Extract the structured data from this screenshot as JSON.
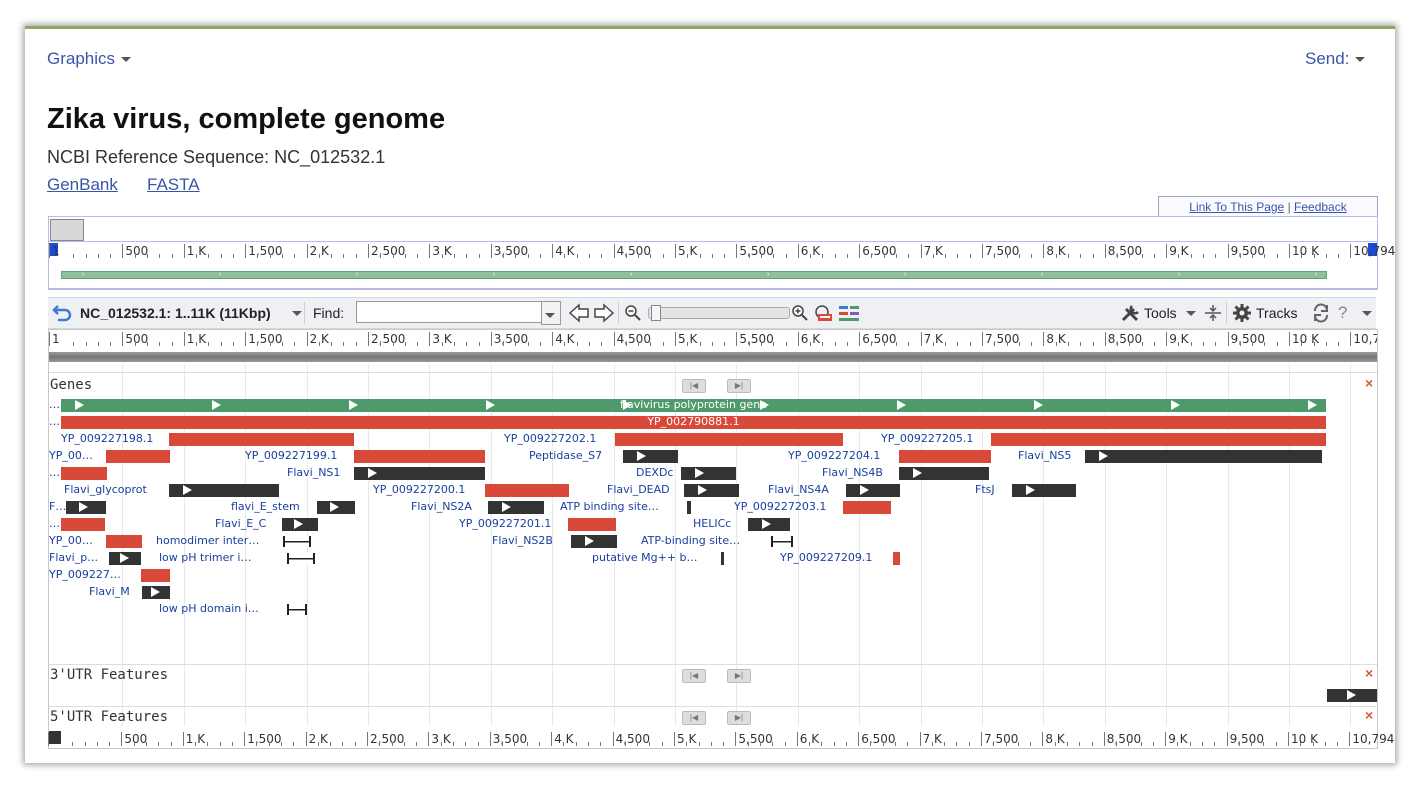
{
  "header": {
    "graphics_menu": "Graphics",
    "send_menu": "Send:",
    "title": "Zika virus, complete genome",
    "subtitle": "NCBI Reference Sequence: NC_012532.1",
    "links": [
      "GenBank",
      "FASTA"
    ]
  },
  "link_box": {
    "link_to_page": "Link To This Page",
    "separator": "|",
    "feedback": "Feedback"
  },
  "ruler_labels": [
    "500",
    "1 K",
    "1,500",
    "2 K",
    "2,500",
    "3 K",
    "3,500",
    "4 K",
    "4,500",
    "5 K",
    "5,500",
    "6 K",
    "6,500",
    "7 K",
    "7,500",
    "8 K",
    "8,500",
    "9 K",
    "9,500",
    "10 K",
    "10,794"
  ],
  "ruler_start_label": "1",
  "toolbar": {
    "sequence_label": "NC_012532.1: 1..11K (11Kbp)",
    "find_label": "Find:",
    "find_value": "",
    "tools_label": "Tools",
    "tracks_label": "Tracks",
    "help_glyph": "?"
  },
  "tracks": {
    "genes": {
      "title": "Genes",
      "features": [
        {
          "label": "…",
          "bar_label": "flavivirus polyprotein gene"
        },
        {
          "label": "…",
          "bar_label": "YP_002790881.1"
        },
        {
          "label": "YP_009227198.1"
        },
        {
          "label": "YP_009227202.1"
        },
        {
          "label": "YP_009227205.1"
        },
        {
          "label": "YP_00…"
        },
        {
          "label": "YP_009227199.1"
        },
        {
          "label": "Peptidase_S7"
        },
        {
          "label": "YP_009227204.1"
        },
        {
          "label": "Flavi_NS5"
        },
        {
          "label": "…"
        },
        {
          "label": "Flavi_NS1"
        },
        {
          "label": "DEXDc"
        },
        {
          "label": "Flavi_NS4B"
        },
        {
          "label": "Flavi_glycoprot"
        },
        {
          "label": "YP_009227200.1"
        },
        {
          "label": "Flavi_DEAD"
        },
        {
          "label": "Flavi_NS4A"
        },
        {
          "label": "FtsJ"
        },
        {
          "label": "F…"
        },
        {
          "label": "flavi_E_stem"
        },
        {
          "label": "Flavi_NS2A"
        },
        {
          "label": "ATP binding site…"
        },
        {
          "label": "YP_009227203.1"
        },
        {
          "label": "…"
        },
        {
          "label": "Flavi_E_C"
        },
        {
          "label": "YP_009227201.1"
        },
        {
          "label": "HELICc"
        },
        {
          "label": "YP_00…"
        },
        {
          "label": "homodimer inter…"
        },
        {
          "label": "Flavi_NS2B"
        },
        {
          "label": "ATP-binding site…"
        },
        {
          "label": "Flavi_p…"
        },
        {
          "label": "low pH trimer i…"
        },
        {
          "label": "putative Mg++ b…"
        },
        {
          "label": "YP_009227209.1"
        },
        {
          "label": "YP_009227…"
        },
        {
          "label": "Flavi_M"
        },
        {
          "label": "low pH domain i…"
        }
      ]
    },
    "utr3": {
      "title": "3'UTR Features"
    },
    "utr5": {
      "title": "5'UTR Features"
    }
  },
  "colors": {
    "cds": "#d9493a",
    "domain": "#333333",
    "gene": "#4e9a6a",
    "link": "#3856a8"
  },
  "icons": [
    "undo-icon",
    "dropdown-icon",
    "back-arrow-icon",
    "forward-arrow-icon",
    "zoom-out-icon",
    "zoom-in-icon",
    "sequence-atg-icon",
    "track-color-icon",
    "tools-icon",
    "collapse-icon",
    "gear-icon",
    "refresh-icon",
    "help-icon",
    "close-icon"
  ]
}
